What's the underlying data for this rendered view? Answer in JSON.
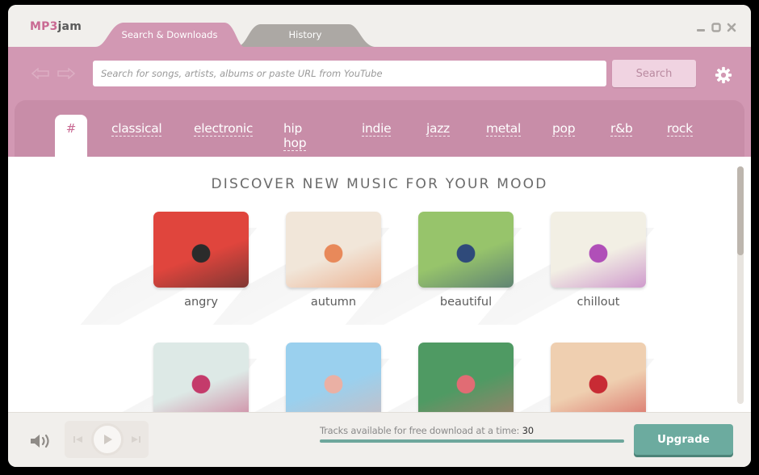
{
  "app": {
    "logo_prefix": "MP3",
    "logo_suffix": "jam"
  },
  "tabs": [
    {
      "label": "Search & Downloads",
      "active": true
    },
    {
      "label": "History",
      "active": false
    }
  ],
  "window_controls": [
    "minimize-icon",
    "maximize-icon",
    "close-icon"
  ],
  "search": {
    "placeholder": "Search for songs, artists, albums or paste URL from YouTube",
    "value": "",
    "button_label": "Search"
  },
  "genres": {
    "active": "#",
    "items": [
      "classical",
      "electronic",
      "hip hop",
      "indie",
      "jazz",
      "metal",
      "pop",
      "r&b",
      "rock"
    ]
  },
  "main": {
    "heading": "DISCOVER NEW MUSIC FOR YOUR MOOD",
    "moods": [
      {
        "label": "angry",
        "colors": [
          "#e0453d",
          "#2b2b2b"
        ]
      },
      {
        "label": "autumn",
        "colors": [
          "#f1e6d9",
          "#e8895a"
        ]
      },
      {
        "label": "beautiful",
        "colors": [
          "#97c46b",
          "#2f4a7a"
        ]
      },
      {
        "label": "chillout",
        "colors": [
          "#f2efe4",
          "#b04fb8"
        ]
      },
      {
        "label": "",
        "colors": [
          "#dde9e6",
          "#c43b6b"
        ]
      },
      {
        "label": "",
        "colors": [
          "#9ad0ee",
          "#eab0a4"
        ]
      },
      {
        "label": "",
        "colors": [
          "#4f9a63",
          "#e16c74"
        ]
      },
      {
        "label": "",
        "colors": [
          "#efcfb0",
          "#c82b34"
        ]
      }
    ]
  },
  "footer": {
    "tracks_label": "Tracks available for free download at a time:",
    "tracks_count": "30",
    "tracks_progress_percent": 100,
    "upgrade_label": "Upgrade"
  },
  "colors": {
    "brand_pink": "#d298b3",
    "accent_teal": "#6cab9f"
  }
}
